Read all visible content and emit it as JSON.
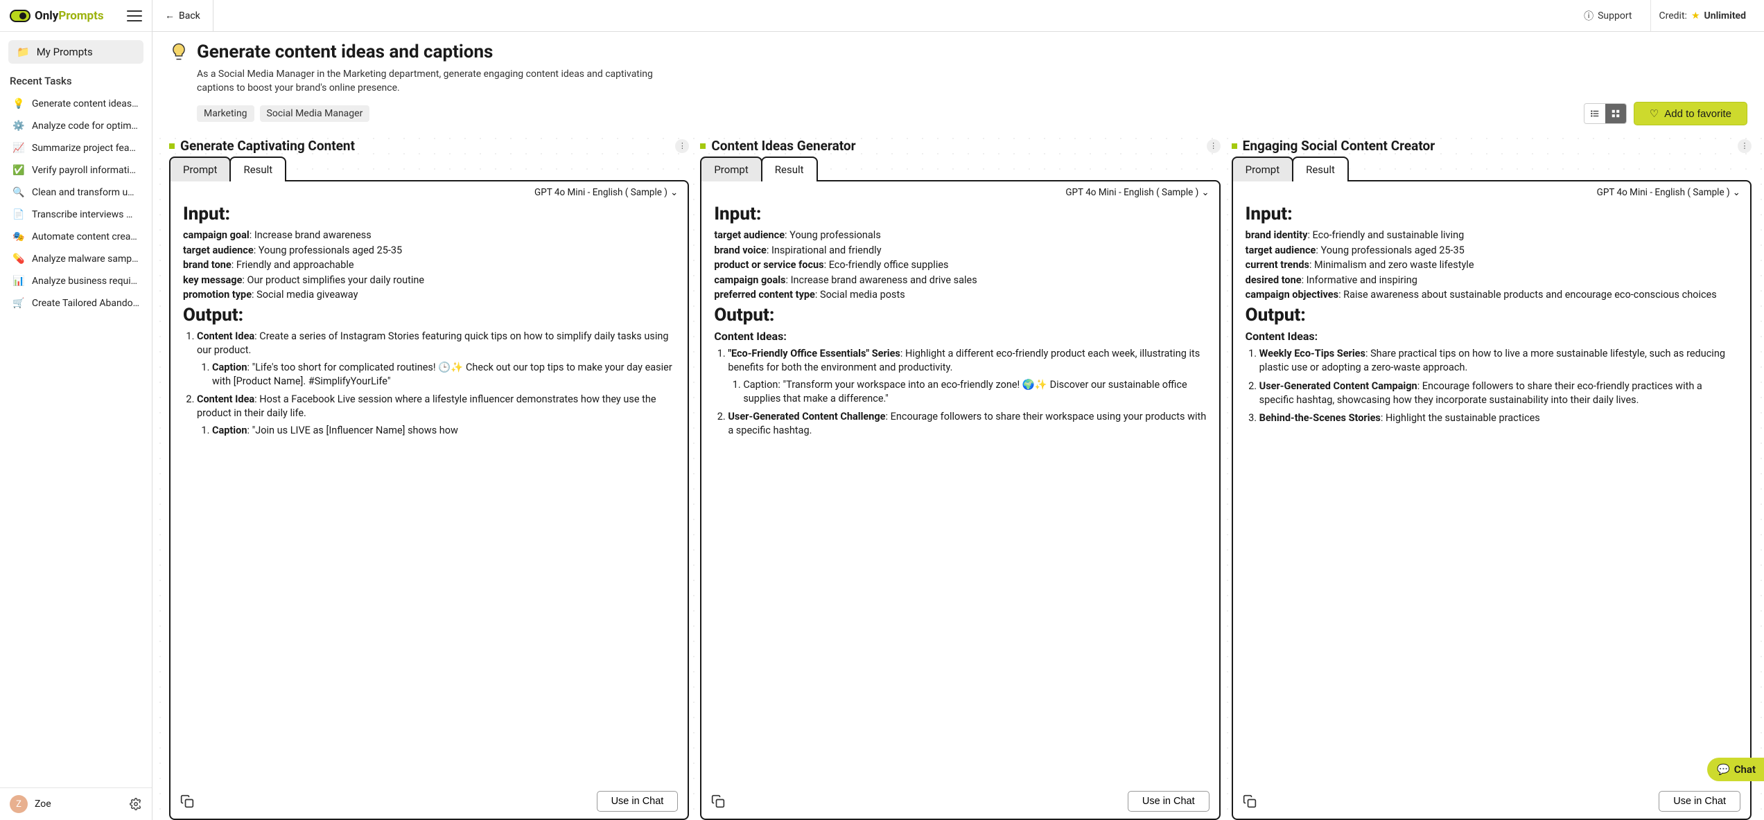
{
  "brand": {
    "part1": "Only",
    "part2": "Prompts"
  },
  "topbar": {
    "back": "Back",
    "support": "Support",
    "credit_label": "Credit:",
    "credit_value": "Unlimited"
  },
  "sidebar": {
    "my_prompts": "My Prompts",
    "recent_heading": "Recent Tasks",
    "recent": [
      {
        "label": "Generate content ideas a...",
        "icon": "bulb"
      },
      {
        "label": "Analyze code for optimiz...",
        "icon": "gear"
      },
      {
        "label": "Summarize project feasi...",
        "icon": "chart"
      },
      {
        "label": "Verify payroll informatio...",
        "icon": "check"
      },
      {
        "label": "Clean and transform uns...",
        "icon": "search"
      },
      {
        "label": "Transcribe interviews wit...",
        "icon": "doc"
      },
      {
        "label": "Automate content creati...",
        "icon": "mask"
      },
      {
        "label": "Analyze malware sample...",
        "icon": "pill"
      },
      {
        "label": "Analyze business require...",
        "icon": "bars"
      },
      {
        "label": "Create Tailored Abandon...",
        "icon": "cart"
      }
    ],
    "user": {
      "initial": "Z",
      "name": "Zoe"
    }
  },
  "page": {
    "title": "Generate content ideas and captions",
    "desc": "As a Social Media Manager in the Marketing department, generate engaging content ideas and captivating captions to boost your brand's online presence.",
    "tags": [
      "Marketing",
      "Social Media Manager"
    ],
    "favorite": "Add to favorite"
  },
  "model_label": "GPT 4o Mini - English ( Sample )",
  "cards": [
    {
      "title": "Generate Captivating Content",
      "tabs": {
        "prompt": "Prompt",
        "result": "Result"
      },
      "input_heading": "Input:",
      "output_heading": "Output:",
      "inputs": [
        {
          "k": "campaign goal",
          "v": ": Increase brand awareness"
        },
        {
          "k": "target audience",
          "v": ": Young professionals aged 25-35"
        },
        {
          "k": "brand tone",
          "v": ": Friendly and approachable"
        },
        {
          "k": "key message",
          "v": ": Our product simplifies your daily routine"
        },
        {
          "k": "promotion type",
          "v": ": Social media giveaway"
        }
      ],
      "items": [
        {
          "lead": "Content Idea",
          "body": ": Create a series of Instagram Stories featuring quick tips on how to simplify daily tasks using our product.",
          "sub": [
            {
              "lead": "Caption",
              "body": ": \"Life's too short for complicated routines! 🕒✨ Check out our top tips to make your day easier with [Product Name]. #SimplifyYourLife\""
            }
          ]
        },
        {
          "lead": "Content Idea",
          "body": ": Host a Facebook Live session where a lifestyle influencer demonstrates how they use the product in their daily life.",
          "sub": [
            {
              "lead": "Caption",
              "body": ": \"Join us LIVE as [Influencer Name] shows how"
            }
          ]
        }
      ],
      "use": "Use in Chat"
    },
    {
      "title": "Content Ideas Generator",
      "tabs": {
        "prompt": "Prompt",
        "result": "Result"
      },
      "input_heading": "Input:",
      "output_heading": "Output:",
      "subhead": "Content Ideas:",
      "inputs": [
        {
          "k": "target audience",
          "v": ": Young professionals"
        },
        {
          "k": "brand voice",
          "v": ": Inspirational and friendly"
        },
        {
          "k": "product or service focus",
          "v": ": Eco-friendly office supplies"
        },
        {
          "k": "campaign goals",
          "v": ": Increase brand awareness and drive sales"
        },
        {
          "k": "preferred content type",
          "v": ": Social media posts"
        }
      ],
      "items": [
        {
          "lead": "\"Eco-Friendly Office Essentials\" Series",
          "body": ": Highlight a different eco-friendly product each week, illustrating its benefits for both the environment and productivity.",
          "sub": [
            {
              "lead": "",
              "body": "Caption: \"Transform your workspace into an eco-friendly zone! 🌍✨ Discover our sustainable office supplies that make a difference.\""
            }
          ]
        },
        {
          "lead": "User-Generated Content Challenge",
          "body": ": Encourage followers to share their workspace using your products with a specific hashtag."
        }
      ],
      "use": "Use in Chat"
    },
    {
      "title": "Engaging Social Content Creator",
      "tabs": {
        "prompt": "Prompt",
        "result": "Result"
      },
      "input_heading": "Input:",
      "output_heading": "Output:",
      "subhead": "Content Ideas:",
      "inputs": [
        {
          "k": "brand identity",
          "v": ": Eco-friendly and sustainable living"
        },
        {
          "k": "target audience",
          "v": ": Young professionals aged 25-35"
        },
        {
          "k": "current trends",
          "v": ": Minimalism and zero waste lifestyle"
        },
        {
          "k": "desired tone",
          "v": ": Informative and inspiring"
        },
        {
          "k": "campaign objectives",
          "v": ": Raise awareness about sustainable products and encourage eco-conscious choices"
        }
      ],
      "items": [
        {
          "lead": "Weekly Eco-Tips Series",
          "body": ": Share practical tips on how to live a more sustainable lifestyle, such as reducing plastic use or adopting a zero-waste approach."
        },
        {
          "lead": "User-Generated Content Campaign",
          "body": ": Encourage followers to share their eco-friendly practices with a specific hashtag, showcasing how they incorporate sustainability into their daily lives."
        },
        {
          "lead": "Behind-the-Scenes Stories",
          "body": ": Highlight the sustainable practices"
        }
      ],
      "use": "Use in Chat"
    }
  ],
  "chat_fab": "Chat"
}
